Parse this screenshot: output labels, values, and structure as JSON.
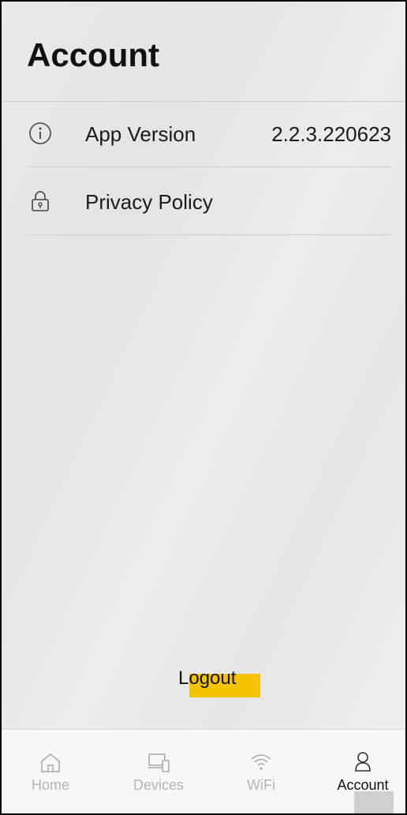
{
  "header": {
    "title": "Account"
  },
  "rows": [
    {
      "icon": "info-icon",
      "label": "App Version",
      "value": "2.2.3.220623"
    },
    {
      "icon": "lock-icon",
      "label": "Privacy Policy"
    }
  ],
  "logout": {
    "label": "Logout",
    "highlight_color": "#f5c400"
  },
  "tabbar": {
    "active": "Account",
    "items": [
      {
        "label": "Home",
        "icon": "home-icon"
      },
      {
        "label": "Devices",
        "icon": "devices-icon"
      },
      {
        "label": "WiFi",
        "icon": "wifi-icon"
      },
      {
        "label": "Account",
        "icon": "person-icon"
      }
    ]
  }
}
